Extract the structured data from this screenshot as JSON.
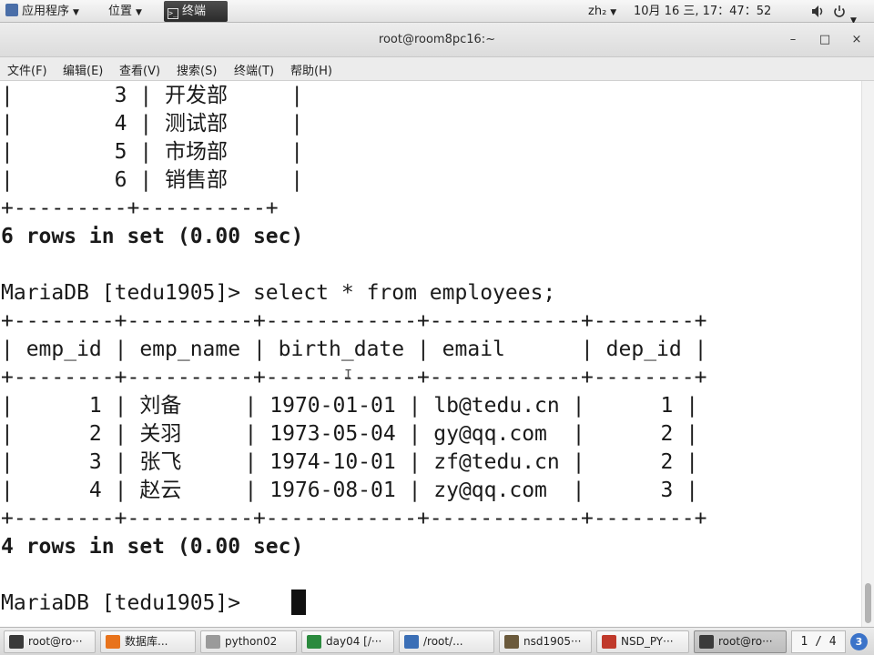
{
  "top_panel": {
    "apps_label": "应用程序",
    "places_label": "位置",
    "terminal_label": "终端",
    "input_method": "zh₂",
    "clock": "10月 16 三, 17：47：52",
    "volume_icon": "speaker-icon",
    "power_icon": "power-icon"
  },
  "window": {
    "title": "root@room8pc16:~",
    "minimize": "–",
    "maximize": "□",
    "close": "×"
  },
  "menu": {
    "file": "文件(F)",
    "edit": "编辑(E)",
    "view": "查看(V)",
    "search": "搜索(S)",
    "terminal": "终端(T)",
    "help": "帮助(H)"
  },
  "terminal_lines": [
    {
      "text": "|        3 | 开发部     |",
      "bold": false
    },
    {
      "text": "|        4 | 测试部     |",
      "bold": false
    },
    {
      "text": "|        5 | 市场部     |",
      "bold": false
    },
    {
      "text": "|        6 | 销售部     |",
      "bold": false
    },
    {
      "text": "+---------+----------+",
      "bold": false
    },
    {
      "text": "6 rows in set (0.00 sec)",
      "bold": true
    },
    {
      "text": "",
      "bold": false
    },
    {
      "text": "MariaDB [tedu1905]> select * from employees;",
      "bold": false
    },
    {
      "text": "+--------+----------+------------+------------+--------+",
      "bold": false
    },
    {
      "text": "| emp_id | emp_name | birth_date | email      | dep_id |",
      "bold": false
    },
    {
      "text": "+--------+----------+------------+------------+--------+",
      "bold": false
    },
    {
      "text": "|      1 | 刘备     | 1970-01-01 | lb@tedu.cn |      1 |",
      "bold": false
    },
    {
      "text": "|      2 | 关羽     | 1973-05-04 | gy@qq.com  |      2 |",
      "bold": false
    },
    {
      "text": "|      3 | 张飞     | 1974-10-01 | zf@tedu.cn |      2 |",
      "bold": false
    },
    {
      "text": "|      4 | 赵云     | 1976-08-01 | zy@qq.com  |      3 |",
      "bold": false
    },
    {
      "text": "+--------+----------+------------+------------+--------+",
      "bold": false
    },
    {
      "text": "4 rows in set (0.00 sec)",
      "bold": true
    },
    {
      "text": "",
      "bold": false
    },
    {
      "text": "MariaDB [tedu1905]> ",
      "bold": false
    }
  ],
  "taskbar": {
    "tasks": [
      {
        "label": "root@ro···",
        "icon": "terminal-icon",
        "color": "#3a3a3a",
        "active": false
      },
      {
        "label": "数据库...",
        "icon": "firefox-icon",
        "color": "#e8731c",
        "active": false
      },
      {
        "label": "python02",
        "icon": "document-icon",
        "color": "#9a9a9a",
        "active": false
      },
      {
        "label": "day04 [/···",
        "icon": "pycharm-icon",
        "color": "#2b8a3e",
        "active": false
      },
      {
        "label": "/root/...",
        "icon": "file-manager-icon",
        "color": "#3b6fb6",
        "active": false
      },
      {
        "label": "nsd1905···",
        "icon": "image-viewer-icon",
        "color": "#6b5a3c",
        "active": false
      },
      {
        "label": "NSD_PY···",
        "icon": "document-viewer-icon",
        "color": "#c0392b",
        "active": false
      },
      {
        "label": "root@ro···",
        "icon": "terminal-icon",
        "color": "#3a3a3a",
        "active": true
      }
    ],
    "workspace": "1 / 4",
    "workspace_badge": "3"
  }
}
